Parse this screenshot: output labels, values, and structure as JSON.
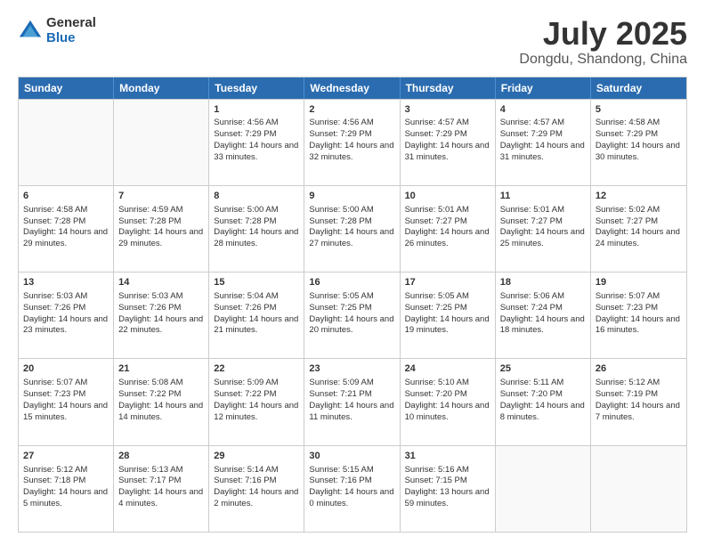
{
  "header": {
    "logo_general": "General",
    "logo_blue": "Blue",
    "title": "July 2025",
    "location": "Dongdu, Shandong, China"
  },
  "calendar": {
    "days": [
      "Sunday",
      "Monday",
      "Tuesday",
      "Wednesday",
      "Thursday",
      "Friday",
      "Saturday"
    ],
    "rows": [
      [
        {
          "day": "",
          "empty": true
        },
        {
          "day": "",
          "empty": true
        },
        {
          "day": "1",
          "sunrise": "Sunrise: 4:56 AM",
          "sunset": "Sunset: 7:29 PM",
          "daylight": "Daylight: 14 hours and 33 minutes."
        },
        {
          "day": "2",
          "sunrise": "Sunrise: 4:56 AM",
          "sunset": "Sunset: 7:29 PM",
          "daylight": "Daylight: 14 hours and 32 minutes."
        },
        {
          "day": "3",
          "sunrise": "Sunrise: 4:57 AM",
          "sunset": "Sunset: 7:29 PM",
          "daylight": "Daylight: 14 hours and 31 minutes."
        },
        {
          "day": "4",
          "sunrise": "Sunrise: 4:57 AM",
          "sunset": "Sunset: 7:29 PM",
          "daylight": "Daylight: 14 hours and 31 minutes."
        },
        {
          "day": "5",
          "sunrise": "Sunrise: 4:58 AM",
          "sunset": "Sunset: 7:29 PM",
          "daylight": "Daylight: 14 hours and 30 minutes."
        }
      ],
      [
        {
          "day": "6",
          "sunrise": "Sunrise: 4:58 AM",
          "sunset": "Sunset: 7:28 PM",
          "daylight": "Daylight: 14 hours and 29 minutes."
        },
        {
          "day": "7",
          "sunrise": "Sunrise: 4:59 AM",
          "sunset": "Sunset: 7:28 PM",
          "daylight": "Daylight: 14 hours and 29 minutes."
        },
        {
          "day": "8",
          "sunrise": "Sunrise: 5:00 AM",
          "sunset": "Sunset: 7:28 PM",
          "daylight": "Daylight: 14 hours and 28 minutes."
        },
        {
          "day": "9",
          "sunrise": "Sunrise: 5:00 AM",
          "sunset": "Sunset: 7:28 PM",
          "daylight": "Daylight: 14 hours and 27 minutes."
        },
        {
          "day": "10",
          "sunrise": "Sunrise: 5:01 AM",
          "sunset": "Sunset: 7:27 PM",
          "daylight": "Daylight: 14 hours and 26 minutes."
        },
        {
          "day": "11",
          "sunrise": "Sunrise: 5:01 AM",
          "sunset": "Sunset: 7:27 PM",
          "daylight": "Daylight: 14 hours and 25 minutes."
        },
        {
          "day": "12",
          "sunrise": "Sunrise: 5:02 AM",
          "sunset": "Sunset: 7:27 PM",
          "daylight": "Daylight: 14 hours and 24 minutes."
        }
      ],
      [
        {
          "day": "13",
          "sunrise": "Sunrise: 5:03 AM",
          "sunset": "Sunset: 7:26 PM",
          "daylight": "Daylight: 14 hours and 23 minutes."
        },
        {
          "day": "14",
          "sunrise": "Sunrise: 5:03 AM",
          "sunset": "Sunset: 7:26 PM",
          "daylight": "Daylight: 14 hours and 22 minutes."
        },
        {
          "day": "15",
          "sunrise": "Sunrise: 5:04 AM",
          "sunset": "Sunset: 7:26 PM",
          "daylight": "Daylight: 14 hours and 21 minutes."
        },
        {
          "day": "16",
          "sunrise": "Sunrise: 5:05 AM",
          "sunset": "Sunset: 7:25 PM",
          "daylight": "Daylight: 14 hours and 20 minutes."
        },
        {
          "day": "17",
          "sunrise": "Sunrise: 5:05 AM",
          "sunset": "Sunset: 7:25 PM",
          "daylight": "Daylight: 14 hours and 19 minutes."
        },
        {
          "day": "18",
          "sunrise": "Sunrise: 5:06 AM",
          "sunset": "Sunset: 7:24 PM",
          "daylight": "Daylight: 14 hours and 18 minutes."
        },
        {
          "day": "19",
          "sunrise": "Sunrise: 5:07 AM",
          "sunset": "Sunset: 7:23 PM",
          "daylight": "Daylight: 14 hours and 16 minutes."
        }
      ],
      [
        {
          "day": "20",
          "sunrise": "Sunrise: 5:07 AM",
          "sunset": "Sunset: 7:23 PM",
          "daylight": "Daylight: 14 hours and 15 minutes."
        },
        {
          "day": "21",
          "sunrise": "Sunrise: 5:08 AM",
          "sunset": "Sunset: 7:22 PM",
          "daylight": "Daylight: 14 hours and 14 minutes."
        },
        {
          "day": "22",
          "sunrise": "Sunrise: 5:09 AM",
          "sunset": "Sunset: 7:22 PM",
          "daylight": "Daylight: 14 hours and 12 minutes."
        },
        {
          "day": "23",
          "sunrise": "Sunrise: 5:09 AM",
          "sunset": "Sunset: 7:21 PM",
          "daylight": "Daylight: 14 hours and 11 minutes."
        },
        {
          "day": "24",
          "sunrise": "Sunrise: 5:10 AM",
          "sunset": "Sunset: 7:20 PM",
          "daylight": "Daylight: 14 hours and 10 minutes."
        },
        {
          "day": "25",
          "sunrise": "Sunrise: 5:11 AM",
          "sunset": "Sunset: 7:20 PM",
          "daylight": "Daylight: 14 hours and 8 minutes."
        },
        {
          "day": "26",
          "sunrise": "Sunrise: 5:12 AM",
          "sunset": "Sunset: 7:19 PM",
          "daylight": "Daylight: 14 hours and 7 minutes."
        }
      ],
      [
        {
          "day": "27",
          "sunrise": "Sunrise: 5:12 AM",
          "sunset": "Sunset: 7:18 PM",
          "daylight": "Daylight: 14 hours and 5 minutes."
        },
        {
          "day": "28",
          "sunrise": "Sunrise: 5:13 AM",
          "sunset": "Sunset: 7:17 PM",
          "daylight": "Daylight: 14 hours and 4 minutes."
        },
        {
          "day": "29",
          "sunrise": "Sunrise: 5:14 AM",
          "sunset": "Sunset: 7:16 PM",
          "daylight": "Daylight: 14 hours and 2 minutes."
        },
        {
          "day": "30",
          "sunrise": "Sunrise: 5:15 AM",
          "sunset": "Sunset: 7:16 PM",
          "daylight": "Daylight: 14 hours and 0 minutes."
        },
        {
          "day": "31",
          "sunrise": "Sunrise: 5:16 AM",
          "sunset": "Sunset: 7:15 PM",
          "daylight": "Daylight: 13 hours and 59 minutes."
        },
        {
          "day": "",
          "empty": true
        },
        {
          "day": "",
          "empty": true
        }
      ]
    ]
  }
}
